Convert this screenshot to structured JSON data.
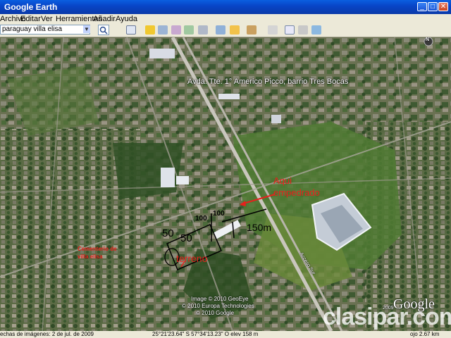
{
  "window": {
    "title": "Google Earth"
  },
  "menu": [
    "Archivo",
    "Editar",
    "Ver",
    "Herramientas",
    "Añadir",
    "Ayuda"
  ],
  "search": {
    "value": "paraguay villa elisa"
  },
  "map": {
    "road_label": "Avda. Tte. 1° Americo Picco, barrio Tres Bocas",
    "aqui_1": "Aqui",
    "aqui_2": "empedrado",
    "dim_100a": "100",
    "dim_100b": "100",
    "dim_150": "150m",
    "dim_50a": "50",
    "dim_50b": "50",
    "terreno": "terreno",
    "cementerio_1": "Cementerio de",
    "cementerio_2": "villa elisa",
    "road_sign": "Acceso Sur",
    "credit_1": "Image © 2010 GeoEye",
    "credit_2": "© 2010 Europa Technologies",
    "credit_3": "© 2010 Google",
    "google_logo": "Google",
    "year": "2009",
    "watermark": "clasipar.com",
    "compass_n": "N"
  },
  "status": {
    "date": "echas de imágenes: 2 de jul. de 2009",
    "coords": "25°21'23.64\" S   57°34'13.23\" O   elev  158 m",
    "eye": "ojo  2.67 km"
  }
}
